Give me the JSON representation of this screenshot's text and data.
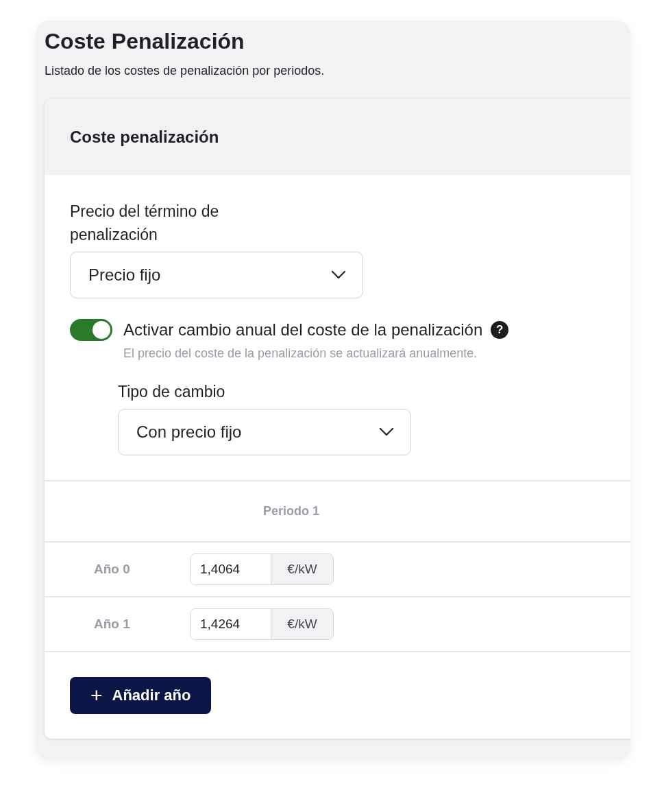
{
  "page": {
    "title": "Coste Penalización",
    "subtitle": "Listado de los costes de penalización por periodos."
  },
  "card": {
    "title": "Coste penalización",
    "price_term": {
      "label": "Precio del término de penalización",
      "value": "Precio fijo"
    },
    "annual_change": {
      "on": true,
      "label": "Activar cambio anual del coste de la penalización",
      "help": "?",
      "hint": "El precio del coste de la penalización se actualizará anualmente."
    },
    "change_type": {
      "label": "Tipo de cambio",
      "value": "Con precio fijo"
    },
    "table": {
      "columns": [
        "Periodo 1"
      ],
      "rows": [
        {
          "label": "Año 0",
          "value": "1,4064",
          "unit": "€/kW"
        },
        {
          "label": "Año 1",
          "value": "1,4264",
          "unit": "€/kW"
        }
      ]
    },
    "add_button": {
      "icon": "+",
      "label": "Añadir año"
    }
  }
}
